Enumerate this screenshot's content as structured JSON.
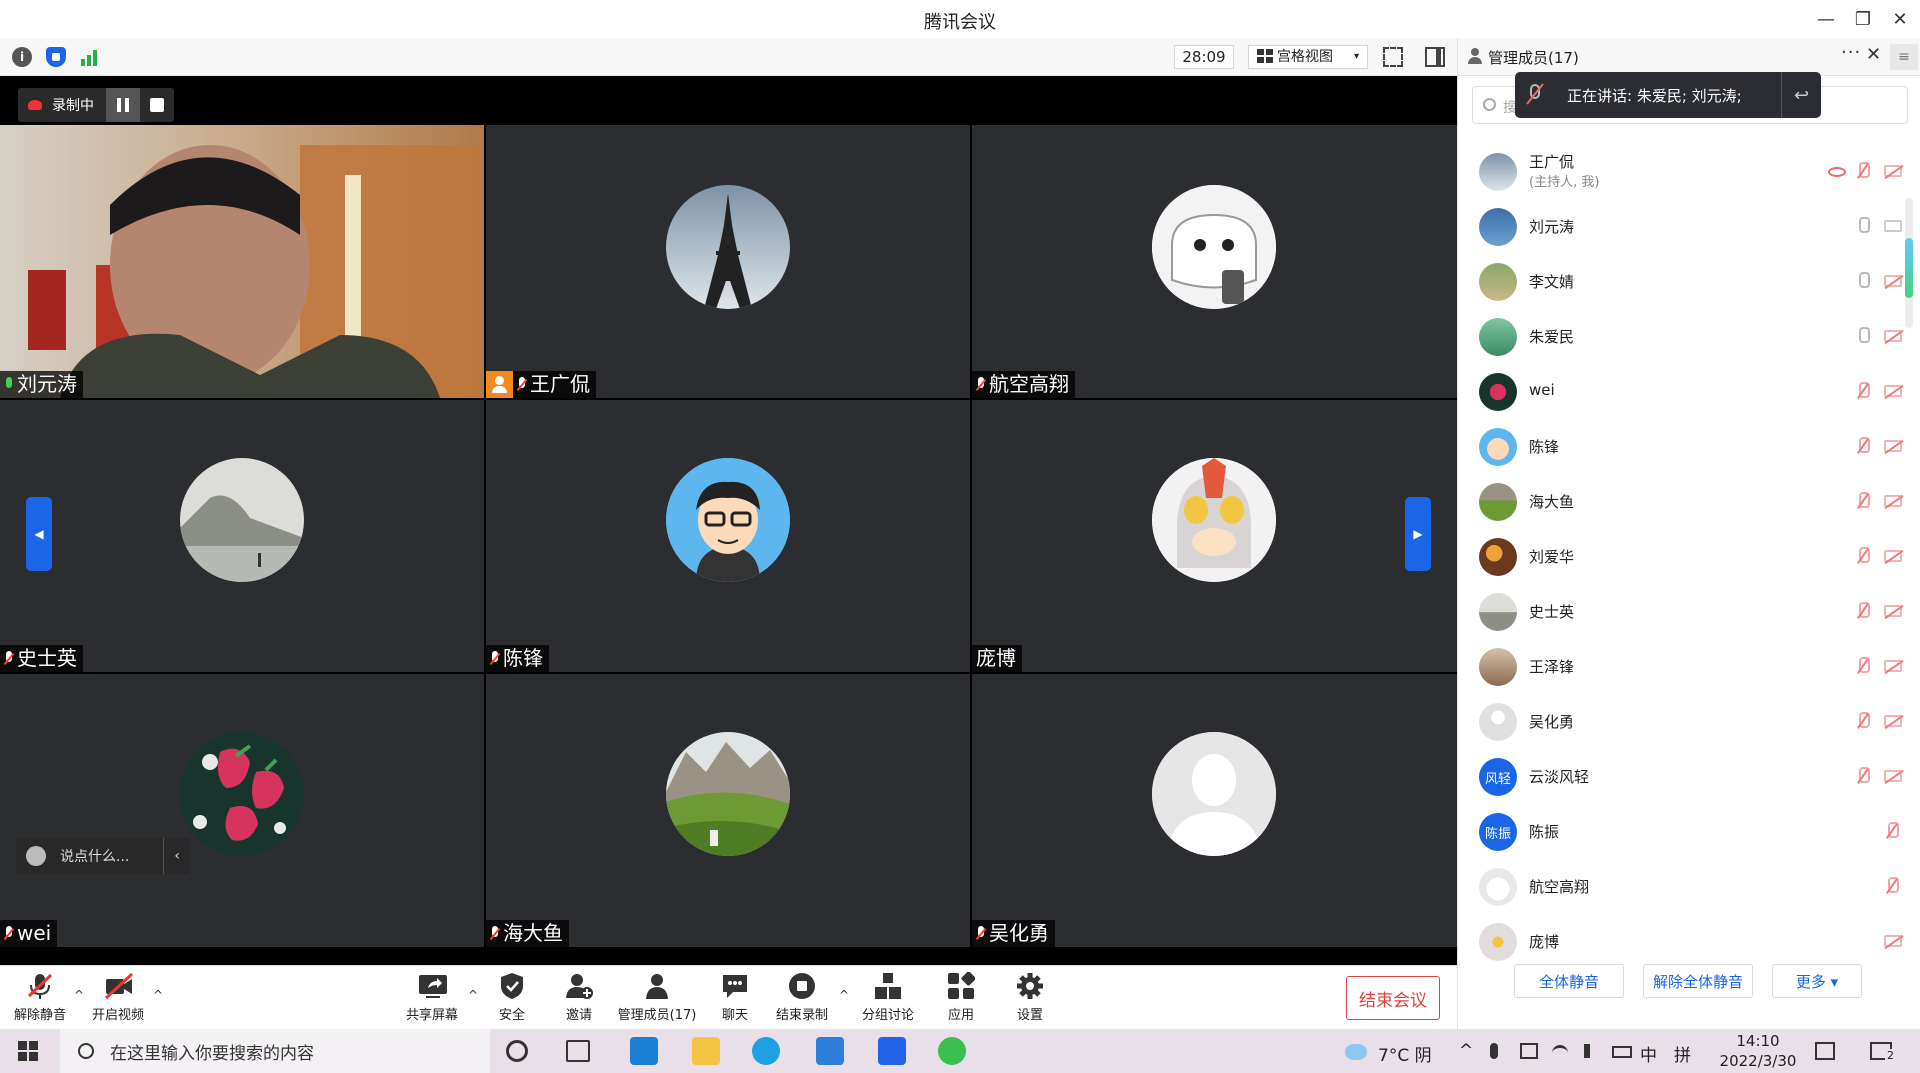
{
  "window": {
    "title": "腾讯会议",
    "minimize": "—",
    "restore": "❐",
    "close": "✕"
  },
  "toolbar": {
    "info_icon": "i",
    "timer": "28:09",
    "view_mode": "宫格视图",
    "view_caret": "▾"
  },
  "recording": {
    "label": "录制中"
  },
  "tiles": [
    {
      "name": "刘元涛",
      "mic": "on",
      "host": false,
      "type": "video"
    },
    {
      "name": "王广侃",
      "mic": "off",
      "host": true,
      "type": "avatar",
      "avatar": "eiffel"
    },
    {
      "name": "航空高翔",
      "mic": "off",
      "host": false,
      "type": "avatar",
      "avatar": "cat"
    },
    {
      "name": "史士英",
      "mic": "off",
      "host": false,
      "type": "avatar",
      "avatar": "mountain-fog"
    },
    {
      "name": "陈锋",
      "mic": "off",
      "host": false,
      "type": "avatar",
      "avatar": "cartoon-man"
    },
    {
      "name": "庞博",
      "mic": "none",
      "host": false,
      "type": "avatar",
      "avatar": "anime"
    },
    {
      "name": "wei",
      "mic": "off",
      "host": false,
      "type": "avatar",
      "avatar": "strawberry"
    },
    {
      "name": "海大鱼",
      "mic": "off",
      "host": false,
      "type": "avatar",
      "avatar": "alps"
    },
    {
      "name": "吴化勇",
      "mic": "off",
      "host": false,
      "type": "avatar",
      "avatar": "default"
    }
  ],
  "nav": {
    "prev": "◀",
    "next": "▶"
  },
  "chat": {
    "placeholder": "说点什么...",
    "collapse": "‹"
  },
  "controls": {
    "unmute": "解除静音",
    "start_video": "开启视频",
    "share": "共享屏幕",
    "security": "安全",
    "invite": "邀请",
    "members": "管理成员(17)",
    "chat": "聊天",
    "end_record": "结束录制",
    "breakout": "分组讨论",
    "apps": "应用",
    "settings": "设置",
    "end_meeting": "结束会议",
    "caret": "^"
  },
  "panel": {
    "title": "管理成员(17)",
    "more": "···",
    "close": "✕",
    "menu": "≡",
    "search_placeholder": "搜",
    "speaking": "正在讲话: 朱爱民; 刘元涛;",
    "reply": "↩",
    "members": [
      {
        "name": "王广侃",
        "sub": "(主持人, 我)",
        "mic": "off",
        "cam": "off",
        "rec": true,
        "avatar": "eiffel"
      },
      {
        "name": "刘元涛",
        "sub": "",
        "mic": "on",
        "cam": "on",
        "rec": false,
        "avatar": "landscape-blue"
      },
      {
        "name": "李文婧",
        "sub": "",
        "mic": "on",
        "cam": "off",
        "rec": false,
        "avatar": "garden"
      },
      {
        "name": "朱爱民",
        "sub": "",
        "mic": "on",
        "cam": "off",
        "rec": false,
        "avatar": "nature-green"
      },
      {
        "name": "wei",
        "sub": "",
        "mic": "off",
        "cam": "off",
        "rec": false,
        "avatar": "strawberry"
      },
      {
        "name": "陈锋",
        "sub": "",
        "mic": "off",
        "cam": "off",
        "rec": false,
        "avatar": "cartoon-man"
      },
      {
        "name": "海大鱼",
        "sub": "",
        "mic": "off",
        "cam": "off",
        "rec": false,
        "avatar": "alps"
      },
      {
        "name": "刘爱华",
        "sub": "",
        "mic": "off",
        "cam": "off",
        "rec": false,
        "avatar": "flowers"
      },
      {
        "name": "史士英",
        "sub": "",
        "mic": "off",
        "cam": "off",
        "rec": false,
        "avatar": "mountain-fog"
      },
      {
        "name": "王泽锋",
        "sub": "",
        "mic": "off",
        "cam": "off",
        "rec": false,
        "avatar": "runner"
      },
      {
        "name": "吴化勇",
        "sub": "",
        "mic": "off",
        "cam": "off",
        "rec": false,
        "avatar": "default"
      },
      {
        "name": "云淡风轻",
        "sub": "",
        "mic": "off",
        "cam": "off",
        "rec": false,
        "avatar": "text-blue",
        "avatar_text": "风轻"
      },
      {
        "name": "陈振",
        "sub": "",
        "mic": "off",
        "cam": "none",
        "rec": false,
        "avatar": "text-blue",
        "avatar_text": "陈振"
      },
      {
        "name": "航空高翔",
        "sub": "",
        "mic": "off",
        "cam": "none",
        "rec": false,
        "avatar": "cat"
      },
      {
        "name": "庞博",
        "sub": "",
        "mic": "none",
        "cam": "off",
        "rec": false,
        "avatar": "anime"
      }
    ],
    "mute_all": "全体静音",
    "unmute_all": "解除全体静音",
    "more_btn": "更多 ▾"
  },
  "taskbar": {
    "search_placeholder": "在这里输入你要搜索的内容",
    "weather": "7°C 阴",
    "ime": "中",
    "ime2": "拼",
    "time": "14:10",
    "date": "2022/3/30",
    "notif": "2"
  },
  "colors": {
    "accent": "#1a66e6",
    "danger": "#e04141",
    "host": "#f08a1c",
    "tile_bg": "#2c2d30"
  }
}
